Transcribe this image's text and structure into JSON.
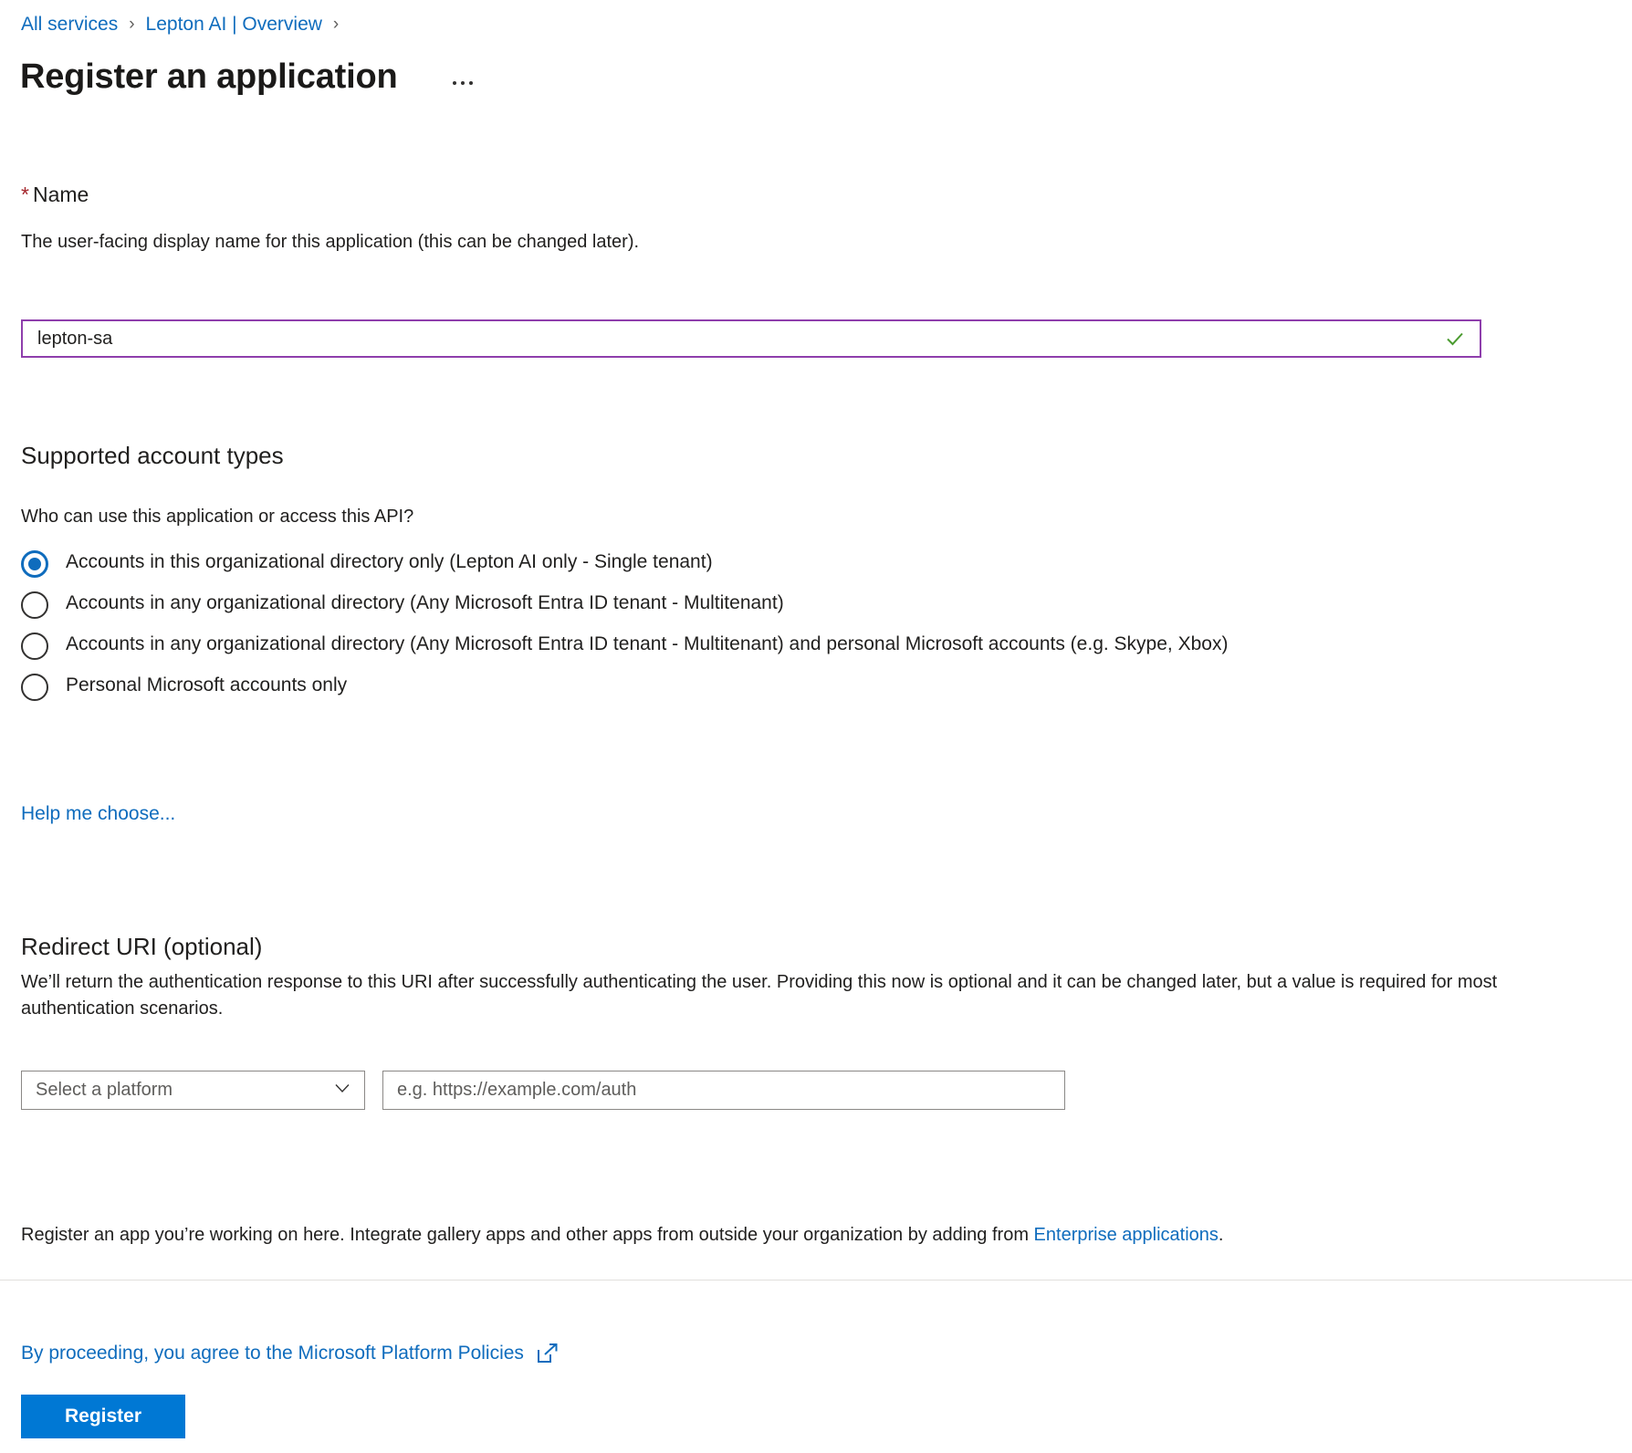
{
  "breadcrumb": {
    "items": [
      {
        "label": "All services"
      },
      {
        "label": "Lepton AI | Overview"
      }
    ],
    "separator": "›"
  },
  "header": {
    "title": "Register an application",
    "more_menu_label": "···"
  },
  "name_section": {
    "required_marker": "*",
    "label": "Name",
    "description": "The user-facing display name for this application (this can be changed later).",
    "value": "lepton-sa",
    "placeholder": "",
    "validation_icon": "checkmark-icon",
    "border_color": "#8E3EAC",
    "check_color": "#4a9b2f"
  },
  "account_types": {
    "heading": "Supported account types",
    "question": "Who can use this application or access this API?",
    "options": [
      {
        "label": "Accounts in this organizational directory only (Lepton AI only - Single tenant)",
        "selected": true
      },
      {
        "label": "Accounts in any organizational directory (Any Microsoft Entra ID tenant - Multitenant)",
        "selected": false
      },
      {
        "label": "Accounts in any organizational directory (Any Microsoft Entra ID tenant - Multitenant) and personal Microsoft accounts (e.g. Skype, Xbox)",
        "selected": false
      },
      {
        "label": "Personal Microsoft accounts only",
        "selected": false
      }
    ],
    "help_link": "Help me choose..."
  },
  "redirect_uri": {
    "heading": "Redirect URI (optional)",
    "description": "We’ll return the authentication response to this URI after successfully authenticating the user. Providing this now is optional and it can be changed later, but a value is required for most authentication scenarios.",
    "platform_select": {
      "selected": "Select a platform",
      "chevron": "chevron-down-icon"
    },
    "uri_input": {
      "value": "",
      "placeholder": "e.g. https://example.com/auth"
    }
  },
  "footer": {
    "note_prefix": "Register an app you’re working on here. Integrate gallery apps and other apps from outside your organization by adding from ",
    "note_link": "Enterprise applications",
    "note_suffix": ".",
    "policies_text": "By proceeding, you agree to the Microsoft Platform Policies",
    "policies_icon": "external-link-icon",
    "register_label": "Register"
  },
  "colors": {
    "link": "#0f6cbd",
    "primary_button": "#0078d4",
    "required_star": "#a4262c",
    "radio_selected": "#0f6cbd"
  }
}
